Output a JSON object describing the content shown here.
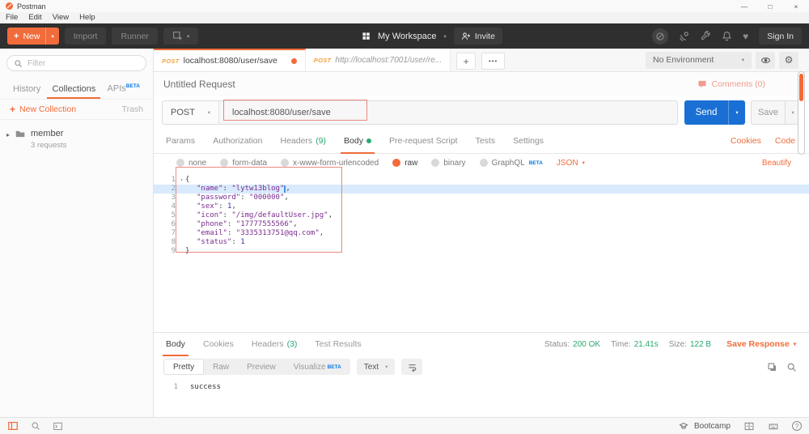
{
  "window": {
    "title": "Postman",
    "menu": [
      "File",
      "Edit",
      "View",
      "Help"
    ],
    "controls": {
      "minimize": "—",
      "maximize": "□",
      "close": "×"
    }
  },
  "toolbar": {
    "new_label": "New",
    "import_label": "Import",
    "runner_label": "Runner",
    "workspace_label": "My Workspace",
    "invite_label": "Invite",
    "signin_label": "Sign In"
  },
  "sidebar": {
    "filter_placeholder": "Filter",
    "tabs": {
      "history": "History",
      "collections": "Collections",
      "apis": "APIs",
      "apis_beta": "BETA"
    },
    "new_collection": "New Collection",
    "trash": "Trash",
    "collection": {
      "name": "member",
      "meta": "3 requests"
    }
  },
  "tabstrip": {
    "tab1": {
      "method": "POST",
      "url": "localhost:8080/user/save"
    },
    "tab2": {
      "method": "POST",
      "url": "http://localhost:7001/user/re..."
    },
    "environment": "No Environment"
  },
  "request": {
    "title": "Untitled Request",
    "comments": "Comments (0)",
    "method": "POST",
    "url": "localhost:8080/user/save",
    "send": "Send",
    "save": "Save",
    "tabs": {
      "params": "Params",
      "authorization": "Authorization",
      "headers": "Headers",
      "headers_count": "(9)",
      "body": "Body",
      "prerequest": "Pre-request Script",
      "tests": "Tests",
      "settings": "Settings"
    },
    "cookies": "Cookies",
    "code": "Code",
    "body_types": {
      "none": "none",
      "form_data": "form-data",
      "urlencoded": "x-www-form-urlencoded",
      "raw": "raw",
      "binary": "binary",
      "graphql": "GraphQL",
      "graphql_beta": "BETA",
      "format": "JSON"
    },
    "beautify": "Beautify",
    "editor": {
      "lines": [
        {
          "num": "1",
          "text": "{"
        },
        {
          "num": "2",
          "key": "\"name\"",
          "sep": ": ",
          "value": "\"lytw13blog\"",
          "tail": ","
        },
        {
          "num": "3",
          "key": "\"password\"",
          "sep": ": ",
          "value": "\"000000\"",
          "tail": ","
        },
        {
          "num": "4",
          "key": "\"sex\"",
          "sep": ": ",
          "value": "1",
          "tail": ","
        },
        {
          "num": "5",
          "key": "\"icon\"",
          "sep": ": ",
          "value": "\"/img/defaultUser.jpg\"",
          "tail": ","
        },
        {
          "num": "6",
          "key": "\"phone\"",
          "sep": ": ",
          "value": "\"17777555566\"",
          "tail": ","
        },
        {
          "num": "7",
          "key": "\"email\"",
          "sep": ": ",
          "value": "\"3335313751@qq.com\"",
          "tail": ","
        },
        {
          "num": "8",
          "key": "\"status\"",
          "sep": ": ",
          "value": "1",
          "tail": ""
        },
        {
          "num": "9",
          "text": "}"
        }
      ]
    }
  },
  "response": {
    "tabs": {
      "body": "Body",
      "cookies": "Cookies",
      "headers": "Headers",
      "headers_count": "(3)",
      "test_results": "Test Results"
    },
    "meta": {
      "status_label": "Status:",
      "status_value": "200 OK",
      "time_label": "Time:",
      "time_value": "21.41s",
      "size_label": "Size:",
      "size_value": "122 B",
      "save_response": "Save Response"
    },
    "toolbar": {
      "pretty": "Pretty",
      "raw": "Raw",
      "preview": "Preview",
      "visualize": "Visualize",
      "visualize_beta": "BETA",
      "text_format": "Text"
    },
    "body": {
      "line_num": "1",
      "text": "success"
    }
  },
  "statusbar": {
    "bootcamp": "Bootcamp"
  },
  "icons": {
    "caret_down": "▾",
    "caret_right": "▸",
    "plus": "+",
    "more": "•••",
    "heart": "♥",
    "gear": "⚙",
    "help": "?"
  },
  "colors": {
    "accent": "#f26b3a",
    "green": "#29a871",
    "beta_blue": "#0b79e6",
    "send_blue": "#1a6fd4",
    "annotation_red": "#e2645a"
  }
}
